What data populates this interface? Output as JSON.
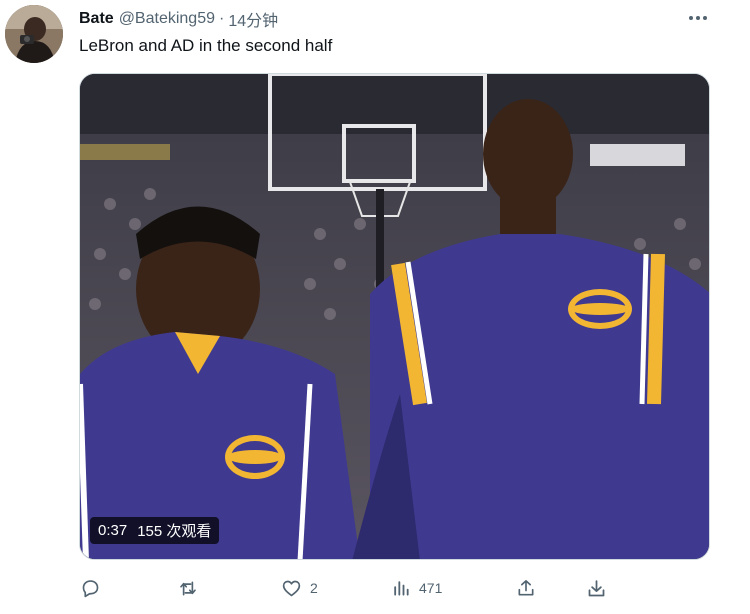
{
  "tweet": {
    "author_name": "Bate",
    "handle": "@Bateking59",
    "separator": "·",
    "time": "14分钟",
    "text": "LeBron and AD in the second half"
  },
  "video": {
    "duration": "0:37",
    "views": "155 次观看"
  },
  "actions": {
    "reply_count": "",
    "retweet_count": "",
    "like_count": "2",
    "view_count": "471"
  },
  "colors": {
    "text_primary": "#0f1419",
    "text_secondary": "#536471",
    "lakers_purple": "#3f3a8f",
    "lakers_gold": "#f2b632"
  }
}
